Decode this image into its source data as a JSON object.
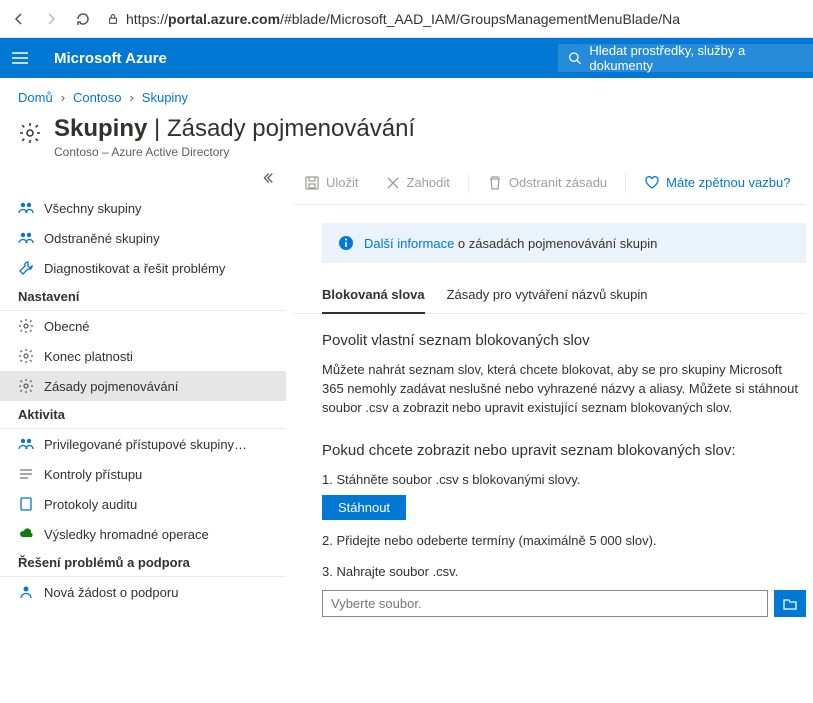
{
  "browser": {
    "url_prefix": "https://",
    "url_host": "portal.azure.com",
    "url_path": "/#blade/Microsoft_AAD_IAM/GroupsManagementMenuBlade/Na"
  },
  "header": {
    "brand": "Microsoft Azure",
    "search_placeholder": "Hledat prostředky, služby a dokumenty"
  },
  "breadcrumbs": [
    "Domů",
    "Contoso",
    "Skupiny"
  ],
  "page": {
    "title_main": "Skupiny",
    "title_sep": " | ",
    "title_sub": "Zásady pojmenovávání",
    "subtitle": "Contoso – Azure Active Directory"
  },
  "sidebar": {
    "top": [
      {
        "label": "Všechny skupiny",
        "icon": "people",
        "color": "#0078d4"
      },
      {
        "label": "Odstraněné skupiny",
        "icon": "people",
        "color": "#0078d4"
      },
      {
        "label": "Diagnostikovat a řešit problémy",
        "icon": "wrench",
        "color": "#0078d4"
      }
    ],
    "sections": [
      {
        "heading": "Nastavení",
        "items": [
          {
            "label": "Obecné",
            "icon": "gear",
            "color": "#605e5c"
          },
          {
            "label": "Konec platnosti",
            "icon": "gear",
            "color": "#605e5c"
          },
          {
            "label": "Zásady pojmenovávání",
            "icon": "gear",
            "color": "#605e5c",
            "active": true
          }
        ]
      },
      {
        "heading": "Aktivita",
        "items": [
          {
            "label": "Privilegované přístupové skupiny…",
            "icon": "people",
            "color": "#0078d4"
          },
          {
            "label": "Kontroly přístupu",
            "icon": "lines",
            "color": "#8a8886"
          },
          {
            "label": "Protokoly auditu",
            "icon": "log",
            "color": "#0078d4"
          },
          {
            "label": "Výsledky hromadné operace",
            "icon": "cloud",
            "color": "#107c10"
          }
        ]
      },
      {
        "heading": "Řešení problémů a podpora",
        "items": [
          {
            "label": "Nová žádost o podporu",
            "icon": "person",
            "color": "#0078d4"
          }
        ]
      }
    ]
  },
  "toolbar": {
    "save": "Uložit",
    "discard": "Zahodit",
    "delete": "Odstranit zásadu",
    "feedback": "Máte zpětnou vazbu?"
  },
  "info_banner": {
    "link": "Další informace",
    "text": " o zásadách pojmenovávání skupin"
  },
  "tabs": [
    {
      "label": "Blokovaná slova",
      "active": true
    },
    {
      "label": "Zásady pro vytváření názvů skupin",
      "active": false
    }
  ],
  "content": {
    "h3": "Povolit vlastní seznam blokovaných slov",
    "p1": "Můžete nahrát seznam slov, která chcete blokovat, aby se pro skupiny Microsoft 365 nemohly zadávat neslušné nebo vyhrazené názvy a aliasy. Můžete si stáhnout soubor .csv a zobrazit nebo upravit existující seznam blokovaných slov.",
    "h4": "Pokud chcete zobrazit nebo upravit seznam blokovaných slov:",
    "step1": "1. Stáhněte soubor .csv s blokovanými slovy.",
    "download": "Stáhnout",
    "step2": "2. Přidejte nebo odeberte termíny (maximálně 5 000 slov).",
    "step3": "3. Nahrajte soubor .csv.",
    "upload_placeholder": "Vyberte soubor."
  }
}
